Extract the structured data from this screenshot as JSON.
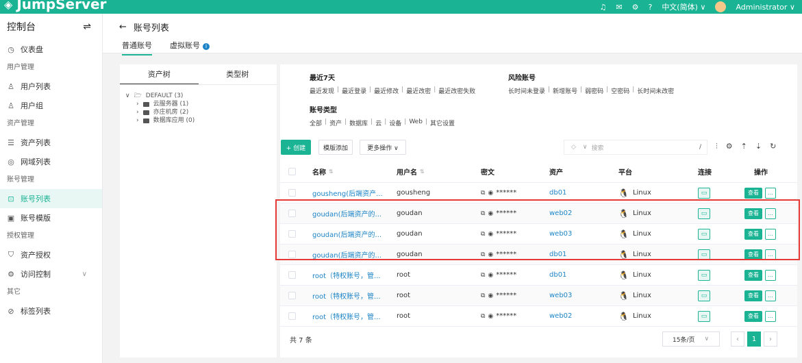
{
  "app": {
    "name": "JumpServer"
  },
  "topbar": {
    "language": "中文(简体) ∨",
    "user": "Administrator ∨"
  },
  "sidebar": {
    "title": "控制台",
    "items": [
      {
        "label": "仪表盘"
      },
      {
        "section": "用户管理"
      },
      {
        "label": "用户列表"
      },
      {
        "label": "用户组"
      },
      {
        "section": "资产管理"
      },
      {
        "label": "资产列表"
      },
      {
        "label": "网域列表"
      },
      {
        "section": "账号管理"
      },
      {
        "label": "账号列表"
      },
      {
        "label": "账号模版"
      },
      {
        "section": "授权管理"
      },
      {
        "label": "资产授权"
      },
      {
        "label": "访问控制"
      },
      {
        "section": "其它"
      },
      {
        "label": "标签列表"
      }
    ]
  },
  "header": {
    "back_title": "账号列表",
    "tab_normal": "普通账号",
    "tab_virtual": "虚拟账号"
  },
  "tree_panel": {
    "tab_asset": "资产树",
    "tab_type": "类型树",
    "root": "DEFAULT (3)",
    "children": [
      "云服务器 (1)",
      "亦庄机房 (2)",
      "数据库应用 (0)"
    ]
  },
  "filters": {
    "recent_title": "最近7天",
    "recent_links": [
      "最近发现",
      "最近登录",
      "最近修改",
      "最近改密",
      "最近改密失败"
    ],
    "risk_title": "风险账号",
    "risk_links": [
      "长时间未登录",
      "新增账号",
      "弱密码",
      "空密码",
      "长时间未改密"
    ],
    "type_title": "账号类型",
    "type_links": [
      "全部",
      "资产",
      "数据库",
      "云",
      "设备",
      "Web",
      "其它设置"
    ]
  },
  "toolbar": {
    "create": "+ 创建",
    "template_add": "模版添加",
    "more_actions": "更多操作 ∨",
    "search_placeholder": "搜索"
  },
  "table": {
    "headers": {
      "name": "名称",
      "username": "用户名",
      "secret": "密文",
      "asset": "资产",
      "platform": "平台",
      "connect": "连接",
      "actions": "操作"
    },
    "rows": [
      {
        "name": "gousheng(后端资产...",
        "username": "gousheng",
        "secret": "******",
        "asset": "db01",
        "platform": "Linux"
      },
      {
        "name": "goudan(后端资产的...",
        "username": "goudan",
        "secret": "******",
        "asset": "web02",
        "platform": "Linux"
      },
      {
        "name": "goudan(后端资产的...",
        "username": "goudan",
        "secret": "******",
        "asset": "web03",
        "platform": "Linux"
      },
      {
        "name": "goudan(后端资产的...",
        "username": "goudan",
        "secret": "******",
        "asset": "db01",
        "platform": "Linux"
      },
      {
        "name": "root（特权账号，管...",
        "username": "root",
        "secret": "******",
        "asset": "db01",
        "platform": "Linux"
      },
      {
        "name": "root（特权账号，管...",
        "username": "root",
        "secret": "******",
        "asset": "web03",
        "platform": "Linux"
      },
      {
        "name": "root（特权账号，管...",
        "username": "root",
        "secret": "******",
        "asset": "web02",
        "platform": "Linux"
      }
    ],
    "view_label": "查看",
    "more_label": "...",
    "total": "共 7 条",
    "page_size": "15条/页",
    "current_page": "1"
  }
}
